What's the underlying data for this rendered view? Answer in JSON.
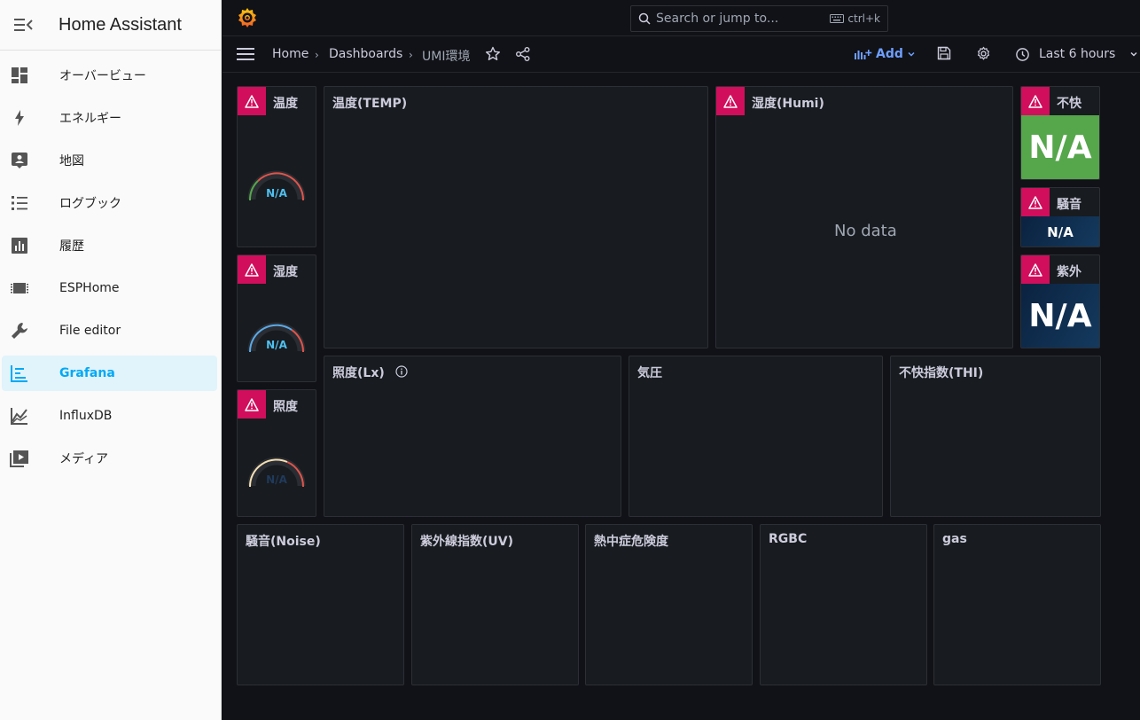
{
  "sidebar": {
    "title": "Home Assistant",
    "items": [
      {
        "label": "オーバービュー",
        "icon": "dashboard-grid-icon"
      },
      {
        "label": "エネルギー",
        "icon": "lightning-icon"
      },
      {
        "label": "地図",
        "icon": "map-person-icon"
      },
      {
        "label": "ログブック",
        "icon": "list-icon"
      },
      {
        "label": "履歴",
        "icon": "bar-chart-icon"
      },
      {
        "label": "ESPHome",
        "icon": "chip-icon"
      },
      {
        "label": "File editor",
        "icon": "wrench-icon"
      },
      {
        "label": "Grafana",
        "icon": "grafana-icon"
      },
      {
        "label": "InfluxDB",
        "icon": "line-chart-icon"
      },
      {
        "label": "メディア",
        "icon": "media-play-icon"
      }
    ],
    "active": "Grafana"
  },
  "topbar": {
    "search_placeholder": "Search or jump to...",
    "shortcut": "ctrl+k"
  },
  "navbar": {
    "breadcrumb": [
      "Home",
      "Dashboards",
      "UMI環境"
    ],
    "add_label": "Add",
    "time_range": "Last 6 hours"
  },
  "panels": {
    "gauge_temp": {
      "title": "温度",
      "value": "N/A"
    },
    "gauge_humi": {
      "title": "湿度",
      "value": "N/A"
    },
    "gauge_lux": {
      "title": "照度",
      "value": "N/A"
    },
    "temp": {
      "title": "温度(TEMP)"
    },
    "humi": {
      "title": "湿度(Humi)",
      "empty": "No data"
    },
    "stat_thi": {
      "title": "不快",
      "value": "N/A"
    },
    "stat_noise": {
      "title": "騒音",
      "value": "N/A"
    },
    "stat_uv": {
      "title": "紫外",
      "value": "N/A"
    },
    "lux": {
      "title": "照度(Lx)"
    },
    "pressure": {
      "title": "気圧"
    },
    "thi": {
      "title": "不快指数(THI)"
    },
    "noise": {
      "title": "騒音(Noise)"
    },
    "uv": {
      "title": "紫外線指数(UV)"
    },
    "heat": {
      "title": "熱中症危険度"
    },
    "rgbc": {
      "title": "RGBC"
    },
    "gas": {
      "title": "gas"
    }
  },
  "colors": {
    "error": "#d10e5c",
    "stat_green": "#56a64b",
    "stat_blue": "#0f2a4a",
    "accent_blue": "#6e9fff",
    "ha_active": "#03a9f4"
  }
}
